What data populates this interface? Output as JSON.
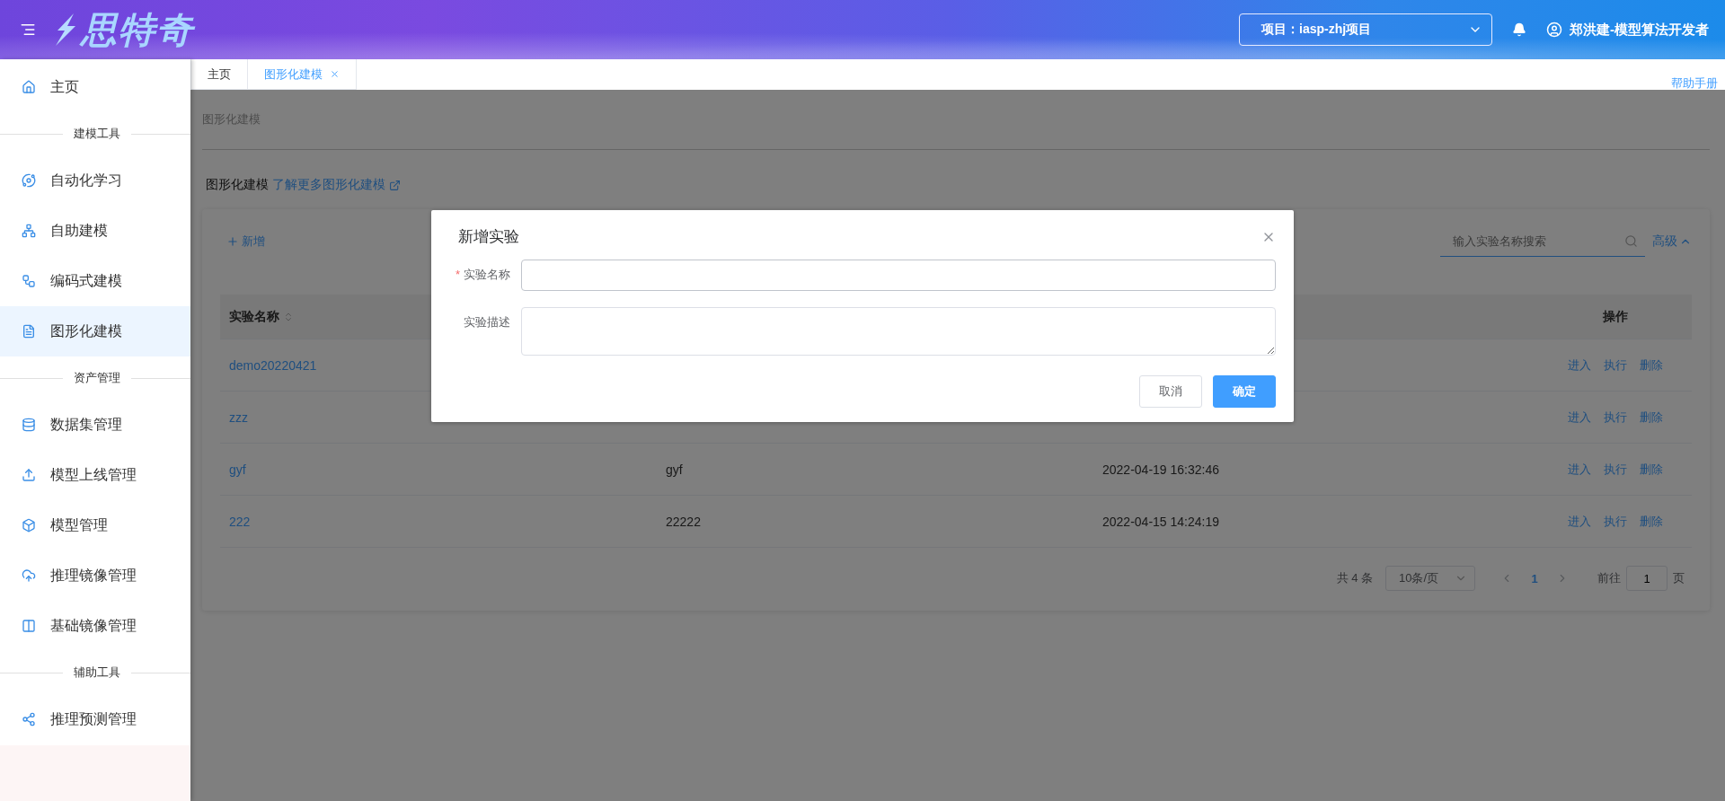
{
  "header": {
    "brand": "思特奇",
    "project": "项目：iasp-zhj项目",
    "user": "郑洪建-模型算法开发者"
  },
  "sidebar": {
    "items": [
      {
        "kind": "link",
        "label": "主页",
        "selected": false
      },
      {
        "kind": "section",
        "label": "建模工具"
      },
      {
        "kind": "link",
        "label": "自动化学习",
        "selected": false
      },
      {
        "kind": "link",
        "label": "自助建模",
        "selected": false
      },
      {
        "kind": "link",
        "label": "编码式建模",
        "selected": false
      },
      {
        "kind": "link",
        "label": "图形化建模",
        "selected": true
      },
      {
        "kind": "section",
        "label": "资产管理"
      },
      {
        "kind": "link",
        "label": "数据集管理",
        "selected": false
      },
      {
        "kind": "link",
        "label": "模型上线管理",
        "selected": false
      },
      {
        "kind": "link",
        "label": "模型管理",
        "selected": false
      },
      {
        "kind": "link",
        "label": "推理镜像管理",
        "selected": false
      },
      {
        "kind": "link",
        "label": "基础镜像管理",
        "selected": false
      },
      {
        "kind": "section",
        "label": "辅助工具"
      },
      {
        "kind": "link",
        "label": "推理预测管理",
        "selected": false
      }
    ]
  },
  "tabs": [
    {
      "label": "主页",
      "selected": false,
      "closable": false
    },
    {
      "label": "图形化建模",
      "selected": true,
      "closable": true
    }
  ],
  "help_link": "帮助手册",
  "breadcrumb": "图形化建模",
  "intro": {
    "title": "图形化建模",
    "link": "了解更多图形化建模"
  },
  "toolbar": {
    "add_button": "新增",
    "search_placeholder": "输入实验名称搜索",
    "advanced": "高级"
  },
  "table": {
    "columns": [
      {
        "label": "实验名称",
        "sortable": true
      },
      {
        "label": "操作",
        "sortable": false
      }
    ],
    "rows": [
      {
        "name": "demo20220421",
        "actions": [
          "进入",
          "执行",
          "删除"
        ]
      },
      {
        "name": "zzz",
        "actions": [
          "进入",
          "执行",
          "删除"
        ]
      },
      {
        "name": "gyf",
        "description": "gyf",
        "created": "2022-04-19 16:32:46",
        "actions": [
          "进入",
          "执行",
          "删除"
        ]
      },
      {
        "name": "222",
        "description": "22222",
        "created": "2022-04-15 14:24:19",
        "actions": [
          "进入",
          "执行",
          "删除"
        ]
      }
    ]
  },
  "pagination": {
    "total": "共 4 条",
    "page_size": "10条/页",
    "pages": [
      {
        "label": "1",
        "selected": true
      }
    ],
    "goto_label": "前往",
    "goto_value": "1",
    "page_suffix": "页"
  },
  "dialog": {
    "title": "新增实验",
    "required_mark": "*",
    "fields": [
      {
        "label": "实验名称",
        "required": true,
        "kind": "input"
      },
      {
        "label": "实验描述",
        "required": false,
        "kind": "textarea"
      }
    ],
    "buttons": [
      {
        "label": "取消",
        "kind": "default"
      },
      {
        "label": "确定",
        "kind": "primary"
      }
    ]
  }
}
